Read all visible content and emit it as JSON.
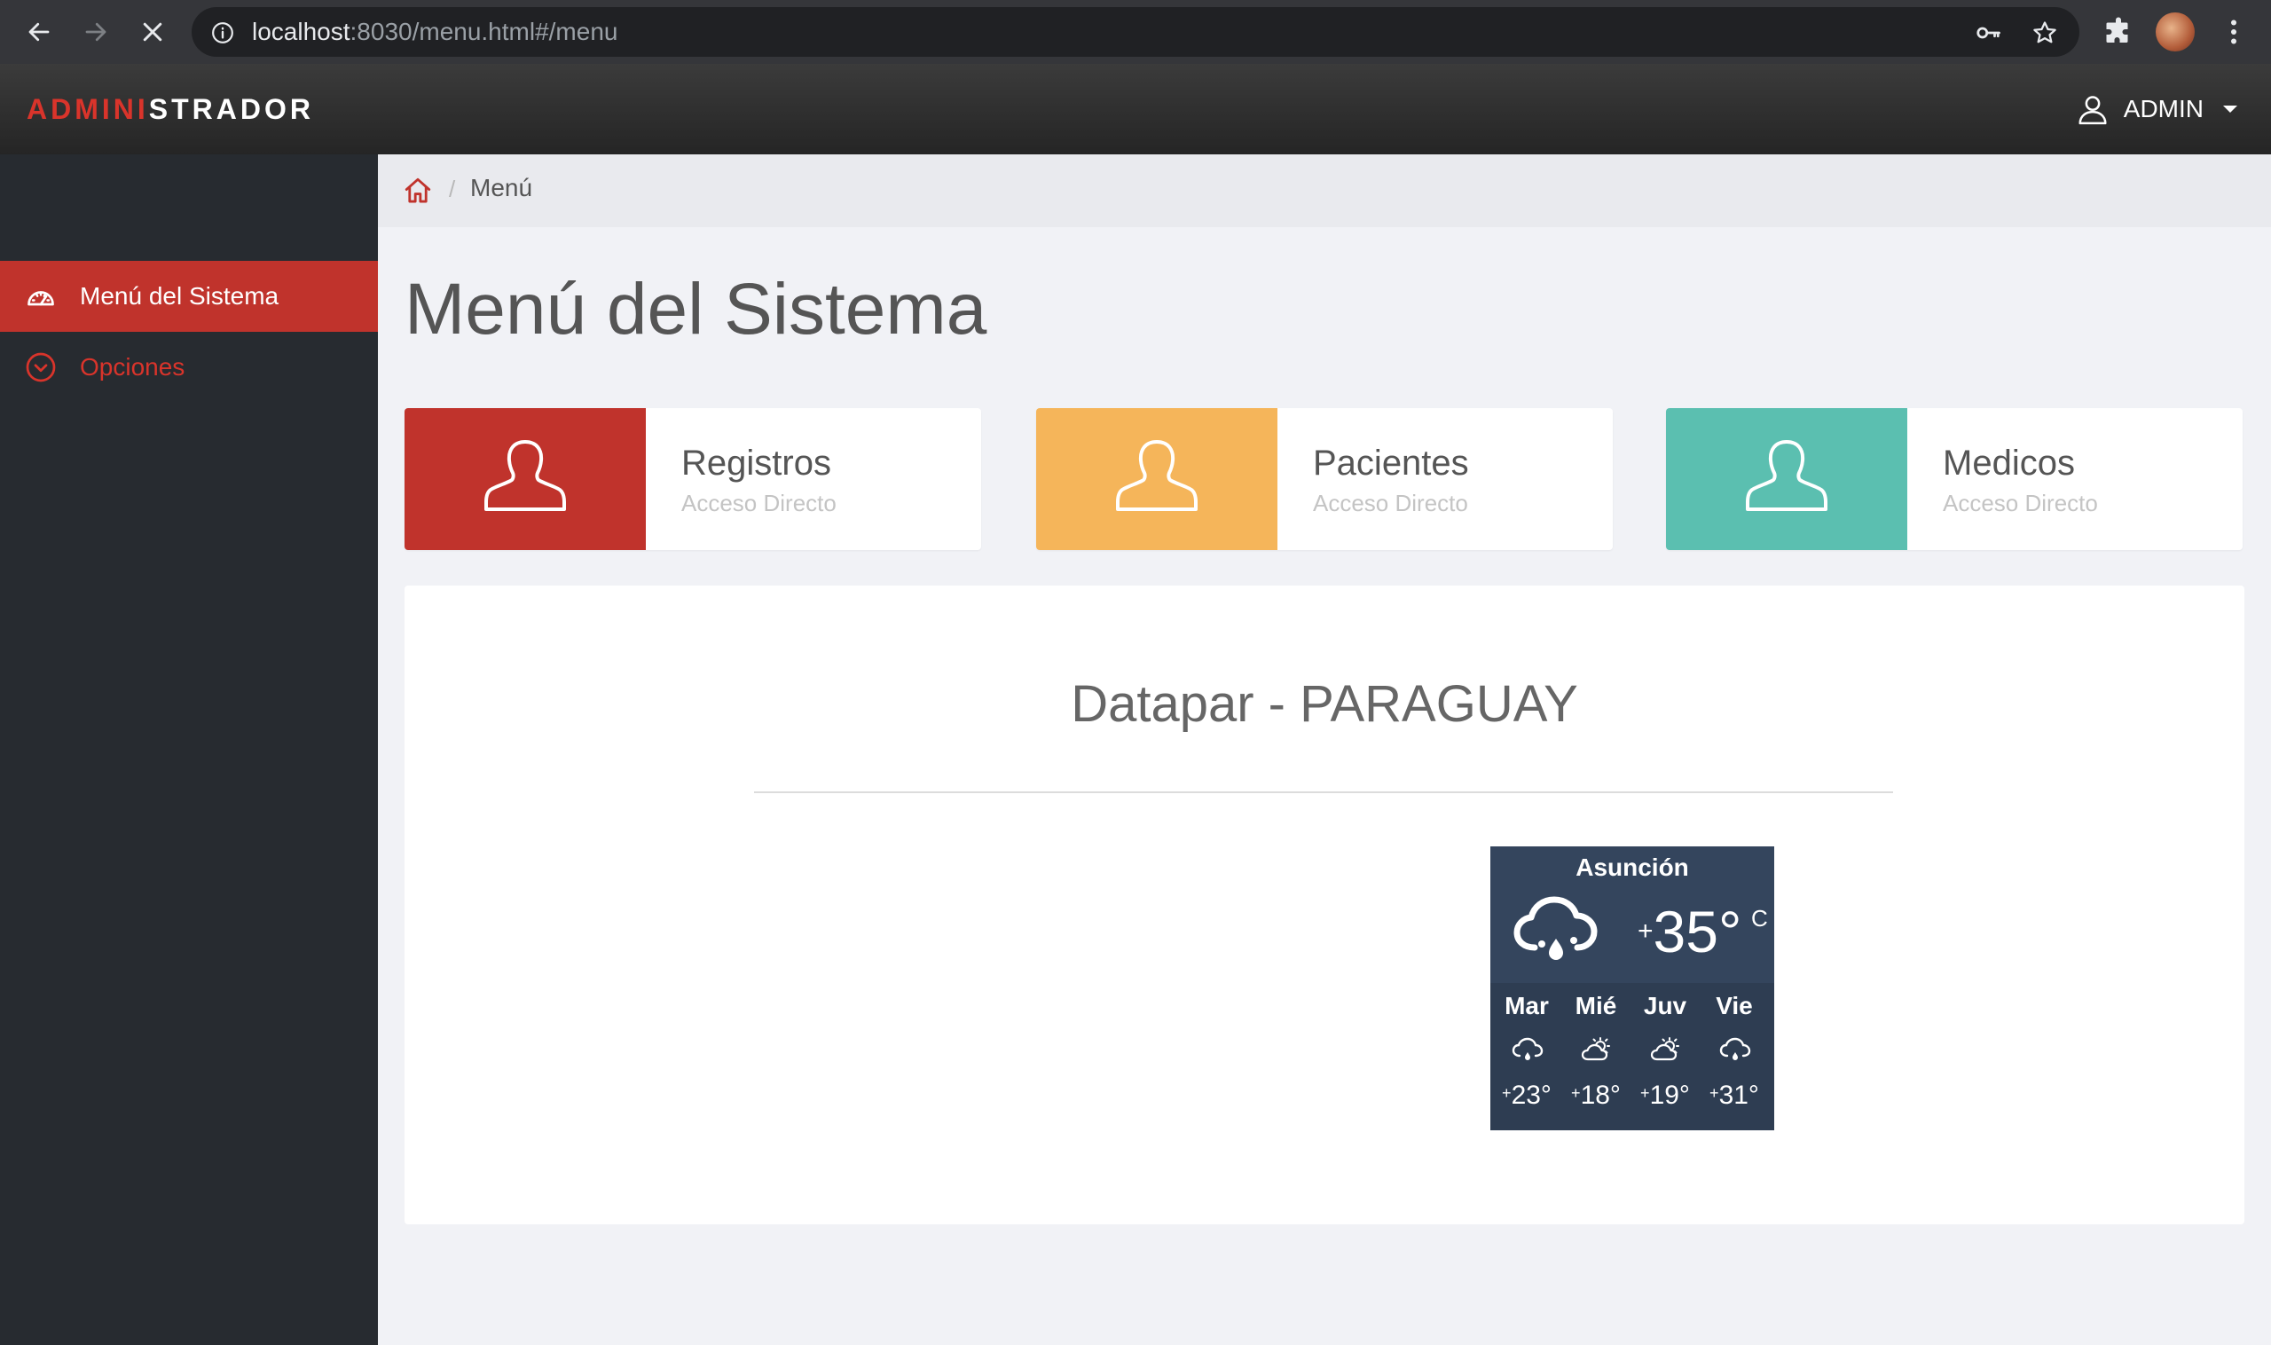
{
  "browser": {
    "url_host": "localhost",
    "url_path": ":8030/menu.html#/menu"
  },
  "header": {
    "brand_red": "ADMINI",
    "brand_white": "STRADOR",
    "user_label": "ADMIN"
  },
  "sidebar": {
    "items": [
      {
        "label": "Menú del Sistema",
        "icon": "dashboard-icon",
        "active": true
      },
      {
        "label": "Opciones",
        "icon": "chevron-circle-icon",
        "active": false
      }
    ]
  },
  "breadcrumb": {
    "current": "Menú"
  },
  "page": {
    "title": "Menú del Sistema"
  },
  "cards": [
    {
      "title": "Registros",
      "subtitle": "Acceso Directo",
      "color": "#c0332c",
      "icon": "user-icon"
    },
    {
      "title": "Pacientes",
      "subtitle": "Acceso Directo",
      "color": "#f5b55a",
      "icon": "user-icon"
    },
    {
      "title": "Medicos",
      "subtitle": "Acceso Directo",
      "color": "#5bbfb0",
      "icon": "user-icon"
    }
  ],
  "panel": {
    "title": "Datapar - PARAGUAY"
  },
  "weather": {
    "city": "Asunción",
    "temp_sign": "+",
    "temp": "35°",
    "unit": "C",
    "days": [
      {
        "name": "Mar",
        "sign": "+",
        "temp": "23°",
        "icon": "rain-cloud-icon"
      },
      {
        "name": "Mié",
        "sign": "+",
        "temp": "18°",
        "icon": "partly-sunny-icon"
      },
      {
        "name": "Juv",
        "sign": "+",
        "temp": "19°",
        "icon": "partly-sunny-icon"
      },
      {
        "name": "Vie",
        "sign": "+",
        "temp": "31°",
        "icon": "rain-cloud-icon"
      }
    ]
  }
}
